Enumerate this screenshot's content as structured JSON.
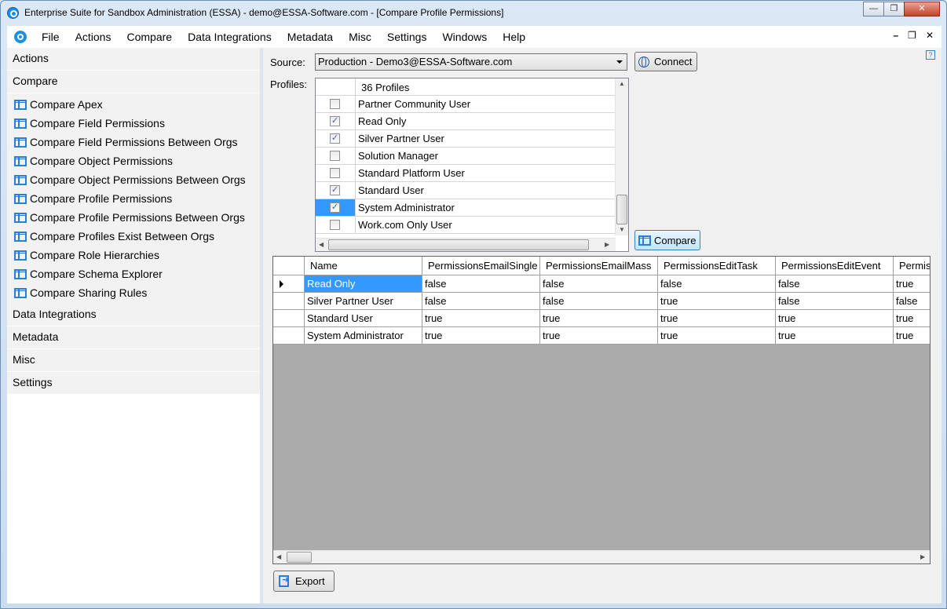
{
  "window": {
    "title": "Enterprise Suite for Sandbox Administration (ESSA) - demo@ESSA-Software.com - [Compare Profile Permissions]"
  },
  "menu": [
    "File",
    "Actions",
    "Compare",
    "Data Integrations",
    "Metadata",
    "Misc",
    "Settings",
    "Windows",
    "Help"
  ],
  "sidebar": {
    "sections_top": [
      "Actions",
      "Compare"
    ],
    "compare_items": [
      "Compare Apex",
      "Compare Field Permissions",
      "Compare Field Permissions Between Orgs",
      "Compare Object Permissions",
      "Compare Object Permissions Between Orgs",
      "Compare Profile Permissions",
      "Compare Profile Permissions Between Orgs",
      "Compare Profiles Exist Between Orgs",
      "Compare Role Hierarchies",
      "Compare Schema Explorer",
      "Compare Sharing Rules"
    ],
    "sections_bottom": [
      "Data Integrations",
      "Metadata",
      "Misc",
      "Settings"
    ]
  },
  "form": {
    "source_label": "Source:",
    "source_value": "Production - Demo3@ESSA-Software.com",
    "connect_label": "Connect",
    "profiles_label": "Profiles:",
    "profiles_header": "36 Profiles",
    "compare_label": "Compare",
    "export_label": "Export"
  },
  "profiles": [
    {
      "name": "Partner Community User",
      "checked": false,
      "selected": false
    },
    {
      "name": "Read Only",
      "checked": true,
      "selected": false
    },
    {
      "name": "Silver Partner User",
      "checked": true,
      "selected": false
    },
    {
      "name": "Solution Manager",
      "checked": false,
      "selected": false
    },
    {
      "name": "Standard Platform User",
      "checked": false,
      "selected": false
    },
    {
      "name": "Standard User",
      "checked": true,
      "selected": false
    },
    {
      "name": "System Administrator",
      "checked": true,
      "selected": true
    },
    {
      "name": "Work.com Only User",
      "checked": false,
      "selected": false
    }
  ],
  "results": {
    "columns": [
      "Name",
      "PermissionsEmailSingle",
      "PermissionsEmailMass",
      "PermissionsEditTask",
      "PermissionsEditEvent",
      "Permis"
    ],
    "rows": [
      [
        "Read Only",
        "false",
        "false",
        "false",
        "false",
        "true"
      ],
      [
        "Silver Partner User",
        "false",
        "false",
        "true",
        "false",
        "false"
      ],
      [
        "Standard User",
        "true",
        "true",
        "true",
        "true",
        "true"
      ],
      [
        "System Administrator",
        "true",
        "true",
        "true",
        "true",
        "true"
      ]
    ]
  }
}
